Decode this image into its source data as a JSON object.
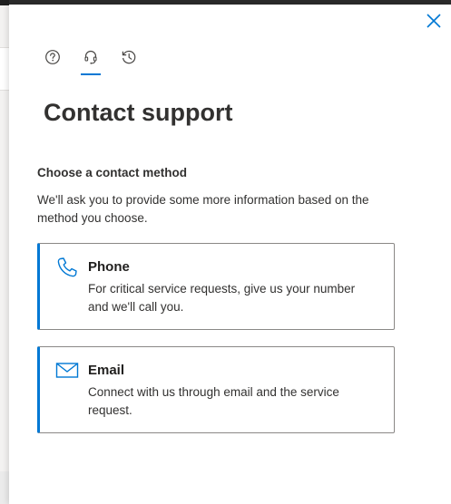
{
  "panel": {
    "close_label": "Close",
    "tabs": [
      {
        "icon": "help-circle-icon",
        "active": false
      },
      {
        "icon": "headset-icon",
        "active": true
      },
      {
        "icon": "history-icon",
        "active": false
      }
    ],
    "title": "Contact support",
    "subheading": "Choose a contact method",
    "description": "We'll ask you to provide some more information based on the method you choose.",
    "methods": [
      {
        "icon": "phone-icon",
        "title": "Phone",
        "description": "For critical service requests, give us your number and we'll call you."
      },
      {
        "icon": "mail-icon",
        "title": "Email",
        "description": "Connect with us through email and the service request."
      }
    ]
  },
  "colors": {
    "accent": "#0078d4",
    "text": "#323130",
    "border": "#8a8886"
  }
}
